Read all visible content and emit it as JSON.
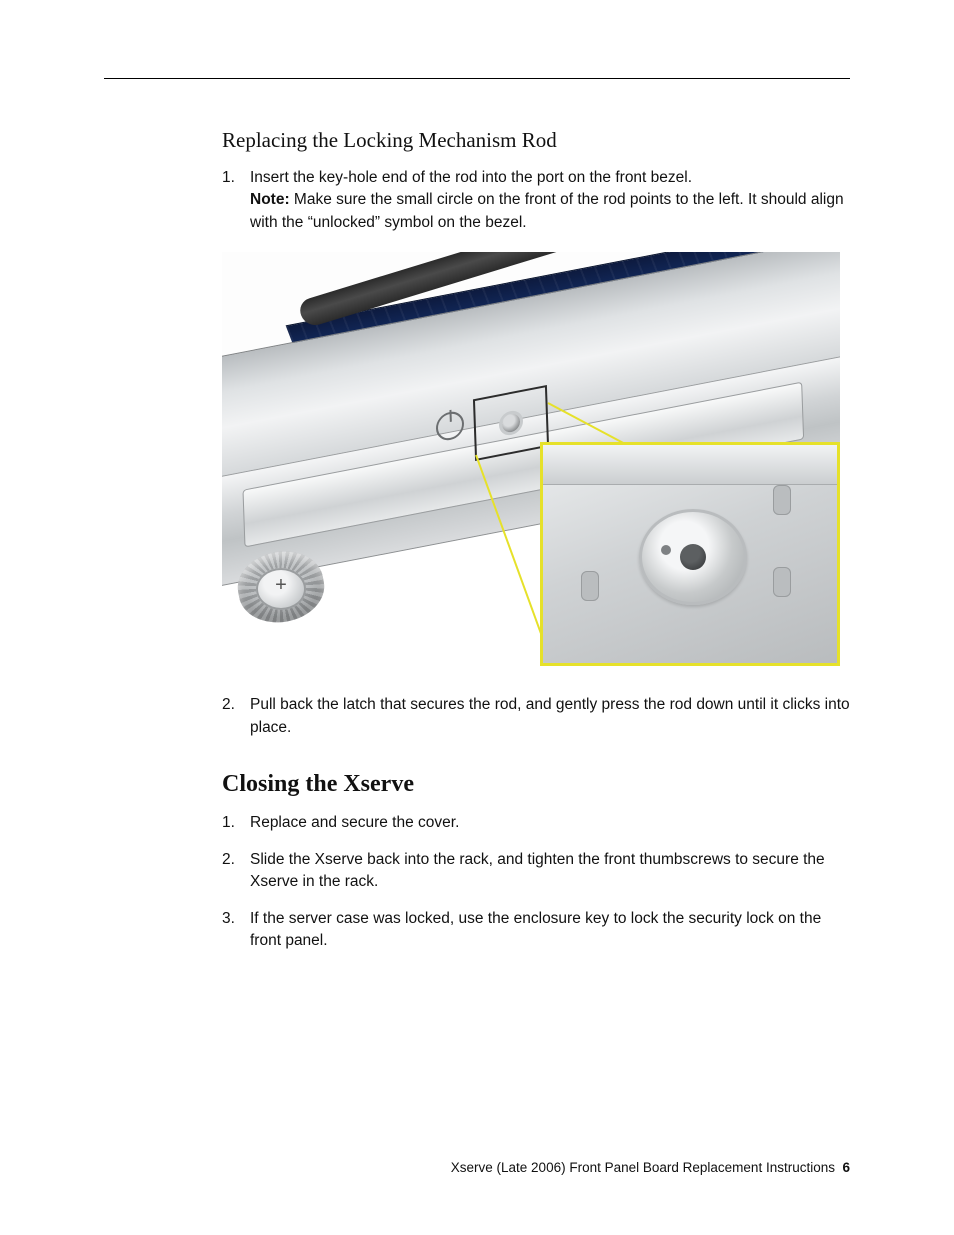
{
  "section1": {
    "title": "Replacing the Locking Mechanism Rod",
    "steps": [
      {
        "num": "1.",
        "line1": "Insert the key-hole end of the rod into the port on the front bezel.",
        "note_label": "Note:",
        "note_rest": " Make sure the small circle on the front of the rod points to the left. It should align with the “unlocked” symbol on the bezel."
      },
      {
        "num": "2.",
        "line1": "Pull back the latch that secures the rod, and gently press the rod down until it clicks into place."
      }
    ]
  },
  "section2": {
    "title": "Closing the Xserve",
    "steps": [
      {
        "num": "1.",
        "line1": "Replace and secure the cover."
      },
      {
        "num": "2.",
        "line1": "Slide the Xserve back into the rack, and tighten the front thumbscrews to secure the Xserve in the rack."
      },
      {
        "num": "3.",
        "line1": "If the server case was locked, use the enclosure key to lock the security lock on the front panel."
      }
    ]
  },
  "footer": {
    "text": "Xserve (Late 2006) Front Panel Board Replacement Instructions",
    "page": "6"
  }
}
